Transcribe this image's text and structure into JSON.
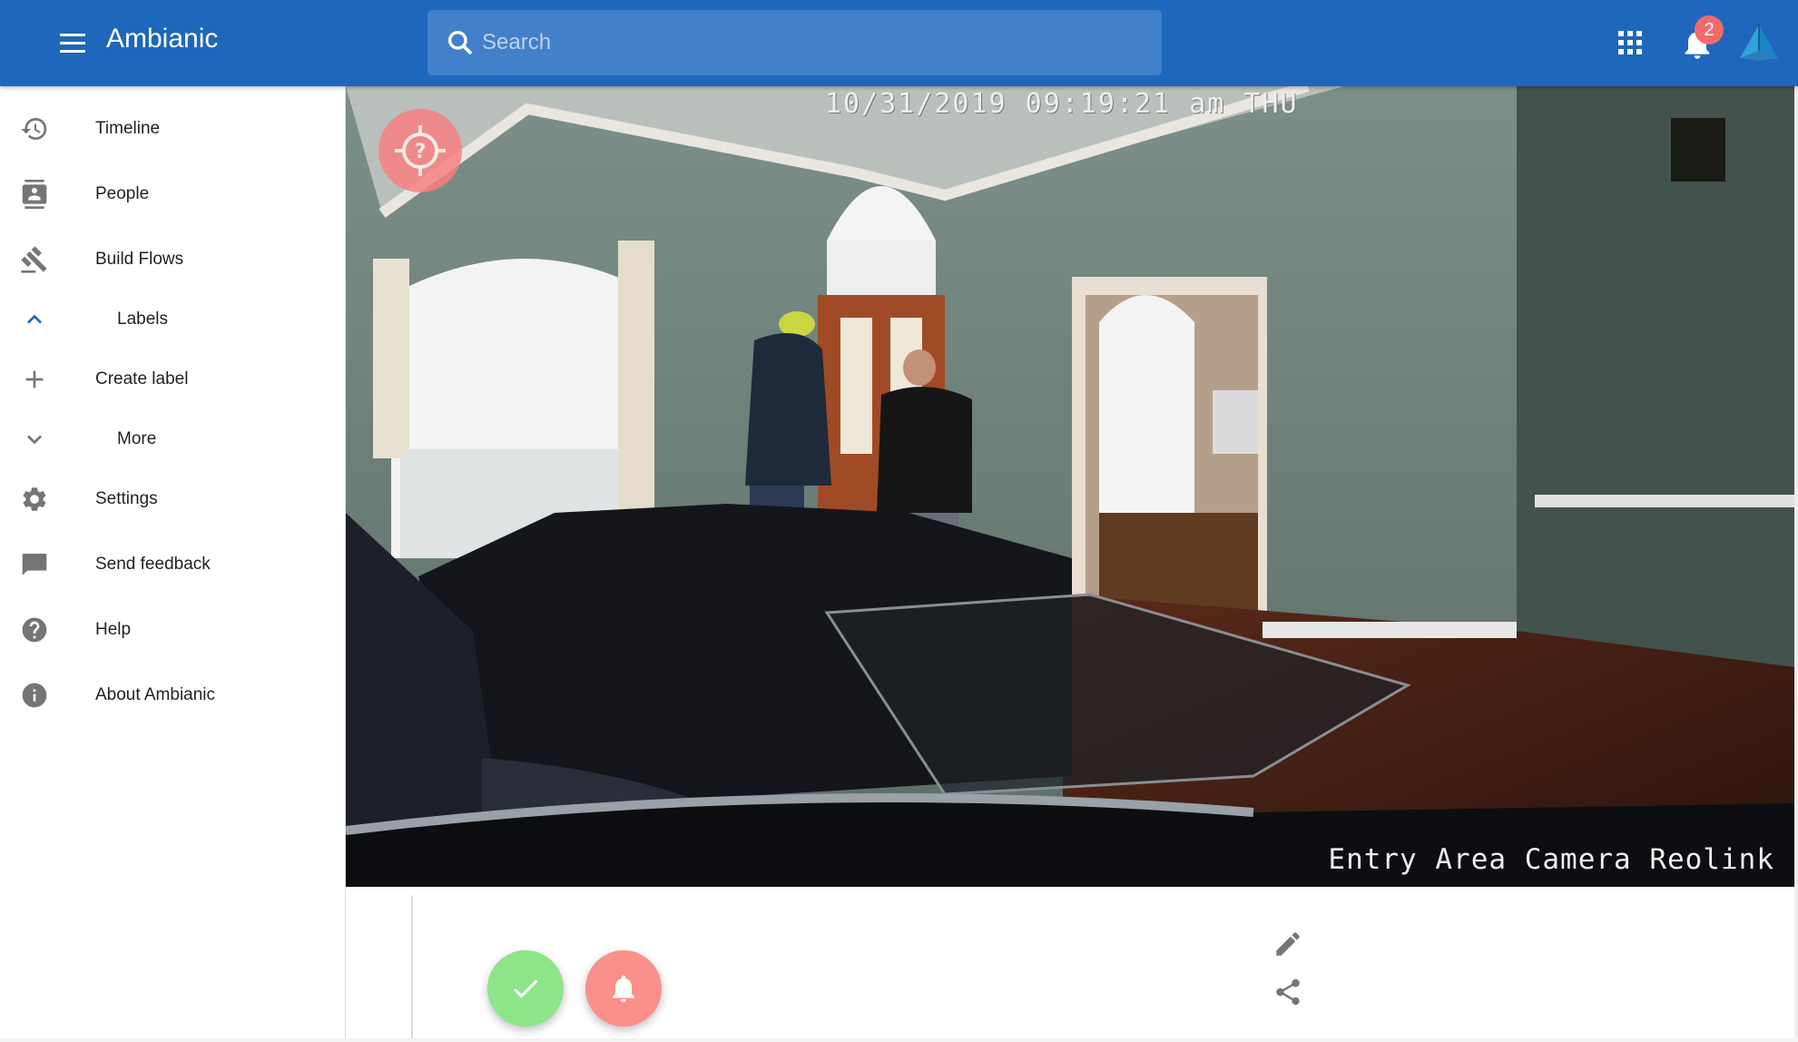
{
  "header": {
    "title": "Ambianic",
    "search_placeholder": "Search",
    "notifications_count": "2",
    "brand_color": "#1e67bc"
  },
  "sidebar": {
    "items": [
      {
        "label": "Timeline",
        "icon": "history-icon"
      },
      {
        "label": "People",
        "icon": "contacts-icon"
      },
      {
        "label": "Build Flows",
        "icon": "gavel-icon"
      },
      {
        "label": "Labels",
        "icon": "chevron-up-icon"
      },
      {
        "label": "Create label",
        "icon": "plus-icon"
      },
      {
        "label": "More",
        "icon": "chevron-down-icon"
      },
      {
        "label": "Settings",
        "icon": "gear-icon"
      },
      {
        "label": "Send feedback",
        "icon": "feedback-icon"
      },
      {
        "label": "Help",
        "icon": "help-icon"
      },
      {
        "label": "About Ambianic",
        "icon": "info-icon"
      }
    ]
  },
  "event": {
    "timestamp_overlay": "10/31/2019 09:19:21 am THU",
    "camera_label": "Entry Area Camera Reolink",
    "detection_icon": "unknown-object-icon",
    "actions": {
      "ok_icon": "check-icon",
      "alert_icon": "bell-icon",
      "edit_icon": "pencil-icon",
      "share_icon": "share-icon"
    },
    "ok_color": "#8de588",
    "alert_color": "#f9908a"
  }
}
